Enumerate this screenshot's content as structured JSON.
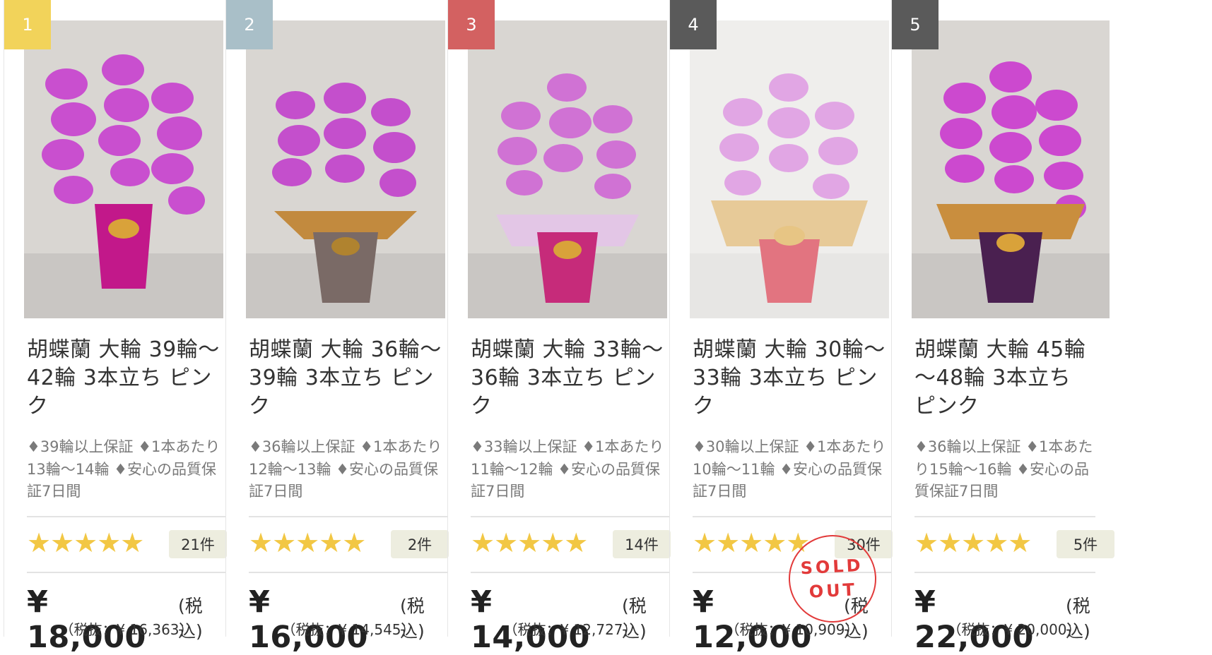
{
  "products": [
    {
      "rank": "1",
      "rank_color": "#f2d35a",
      "title": "胡蝶蘭 大輪 39輪～42輪 3本立ち ピンク",
      "desc": "♦39輪以上保証 ♦1本あたり13輪～14輪 ♦安心の品質保証7日間",
      "rating": "★★★★★",
      "reviews": "21件",
      "price": "¥ 18,000",
      "tax_included": "(税込)",
      "tax_excluded": "（税抜：¥ 16,363）",
      "pot_color": "#c2188a",
      "sold_out": false
    },
    {
      "rank": "2",
      "rank_color": "#a9bfc8",
      "title": "胡蝶蘭 大輪 36輪～39輪 3本立ち ピンク",
      "desc": "♦36輪以上保証 ♦1本あたり12輪～13輪 ♦安心の品質保証7日間",
      "rating": "★★★★★",
      "reviews": "2件",
      "price": "¥ 16,000",
      "tax_included": "(税込)",
      "tax_excluded": "（税抜：¥ 14,545）",
      "pot_color": "#7a6a66",
      "sold_out": false
    },
    {
      "rank": "3",
      "rank_color": "#d36161",
      "title": "胡蝶蘭 大輪 33輪～36輪 3本立ち ピンク",
      "desc": "♦33輪以上保証 ♦1本あたり11輪～12輪 ♦安心の品質保証7日間",
      "rating": "★★★★★",
      "reviews": "14件",
      "price": "¥ 14,000",
      "tax_included": "(税込)",
      "tax_excluded": "（税抜：¥ 12,727）",
      "pot_color": "#c62b7a",
      "sold_out": false
    },
    {
      "rank": "4",
      "rank_color": "#5a5a5a",
      "title": "胡蝶蘭 大輪 30輪～33輪 3本立ち ピンク",
      "desc": "♦30輪以上保証 ♦1本あたり10輪～11輪 ♦安心の品質保証7日間",
      "rating": "★★★★★",
      "reviews": "30件",
      "price": "¥ 12,000",
      "tax_included": "(税込)",
      "tax_excluded": "（税抜：¥ 10,909）",
      "pot_color": "#d12034",
      "sold_out": true,
      "sold_out_line1": "SOLD",
      "sold_out_line2": "OUT"
    },
    {
      "rank": "5",
      "rank_color": "#5a5a5a",
      "title": "胡蝶蘭 大輪 45輪～48輪 3本立ち ピンク",
      "desc": "♦36輪以上保証 ♦1本あたり15輪～16輪 ♦安心の品質保証7日間",
      "rating": "★★★★★",
      "reviews": "5件",
      "price": "¥ 22,000",
      "tax_included": "(税込)",
      "tax_excluded": "（税抜：¥ 20,000）",
      "pot_color": "#4a2050",
      "sold_out": false
    }
  ]
}
